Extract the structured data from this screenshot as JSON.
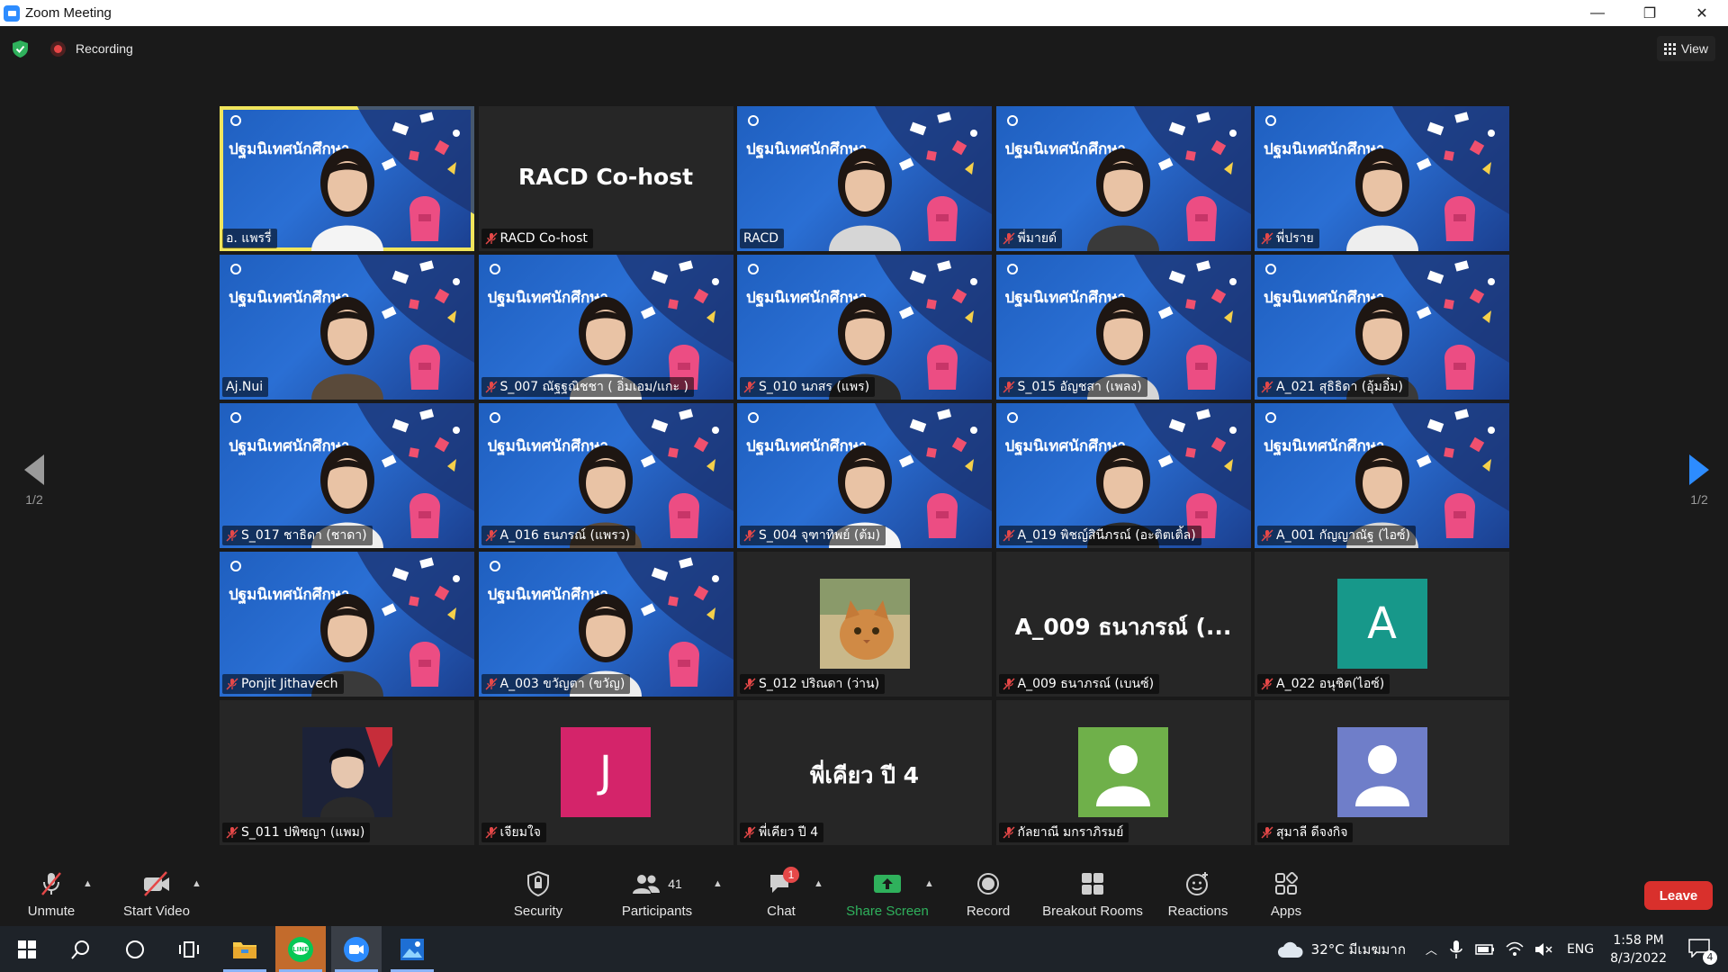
{
  "window": {
    "title": "Zoom Meeting",
    "controls": [
      "—",
      "❐",
      "✕"
    ]
  },
  "topbar": {
    "recording_label": "Recording",
    "view_label": "View"
  },
  "pagination": {
    "left_label": "1/2",
    "right_label": "1/2"
  },
  "colors": {
    "accent": "#2d8cff",
    "active_speaker": "#f0e55c",
    "leave": "#d9302c",
    "share": "#2fb15c",
    "muted": "#e54848"
  },
  "banner_text": "ปฐมนิเทศนักศึกษา",
  "tiles": [
    {
      "name": "อ. แพรรี่",
      "type": "video",
      "muted": false,
      "active": true
    },
    {
      "name": "RACD Co-host",
      "type": "name",
      "display": "RACD Co-host",
      "muted": true
    },
    {
      "name": "RACD",
      "type": "video",
      "muted": false
    },
    {
      "name": "พี่มายด์",
      "type": "video",
      "muted": true
    },
    {
      "name": "พี่ปราย",
      "type": "video",
      "muted": true
    },
    {
      "name": "Aj.Nui",
      "type": "video",
      "muted": false
    },
    {
      "name": "S_007 ณัฐฐณิชชา ( อิ่มเอม/แกะ )",
      "type": "video",
      "muted": true
    },
    {
      "name": "S_010 นภสร (แพร)",
      "type": "video",
      "muted": true
    },
    {
      "name": "S_015 อัญชสา (เพลง)",
      "type": "video",
      "muted": true
    },
    {
      "name": "A_021 สุธิธิดา (อุ้มอิ๋ม)",
      "type": "video",
      "muted": true
    },
    {
      "name": "S_017 ชาธิดา (ชาดา)",
      "type": "video",
      "muted": true
    },
    {
      "name": "A_016 ธนภรณ์ (แพรว)",
      "type": "video",
      "muted": true
    },
    {
      "name": "S_004 จุฑาทิพย์ (ต้ม)",
      "type": "video",
      "muted": true
    },
    {
      "name": "A_019 พิชญ์สินีภรณ์ (อะติตเติ้ล)",
      "type": "video",
      "muted": true
    },
    {
      "name": "A_001 กัญญาณัฐ (ไอซ์)",
      "type": "video",
      "muted": true
    },
    {
      "name": "Ponjit Jithavech",
      "type": "video",
      "muted": true
    },
    {
      "name": "A_003 ขวัญตา (ขวัญ)",
      "type": "video",
      "muted": true
    },
    {
      "name": "S_012 ปริณดา (ว่าน)",
      "type": "photo",
      "photo": "cat",
      "muted": true
    },
    {
      "name": "A_009 ธนาภรณ์ (เบนซ์)",
      "type": "name",
      "display": "A_009 ธนาภรณ์ (...",
      "muted": true
    },
    {
      "name": "A_022 อนุชิต(ไอซ์)",
      "type": "letter",
      "letter": "A",
      "avatar_color": "#17988a",
      "muted": true
    },
    {
      "name": "S_011 ปพิชญา (แพม)",
      "type": "photo",
      "photo": "portrait",
      "muted": true
    },
    {
      "name": "เจียมใจ",
      "type": "letter",
      "letter": "J",
      "avatar_color": "#d4246a",
      "muted": true
    },
    {
      "name": "พี่เคียว ปี 4",
      "type": "name",
      "display": "พี่เคียว ปี 4",
      "muted": true
    },
    {
      "name": "กัลยาณี มกราภิรมย์",
      "type": "person",
      "avatar_color": "#6fb04a",
      "muted": true
    },
    {
      "name": "สุมาลี ดีจงกิจ",
      "type": "person",
      "avatar_color": "#6f7ec9",
      "muted": true
    }
  ],
  "toolbar": {
    "unmute": "Unmute",
    "start_video": "Start Video",
    "security": "Security",
    "participants": "Participants",
    "participants_count": "41",
    "chat": "Chat",
    "chat_badge": "1",
    "share_screen": "Share Screen",
    "record": "Record",
    "breakout_rooms": "Breakout Rooms",
    "reactions": "Reactions",
    "apps": "Apps",
    "leave": "Leave"
  },
  "taskbar": {
    "weather": "32°C มีเมฆมาก",
    "language": "ENG",
    "time": "1:58 PM",
    "date": "8/3/2022",
    "notification_count": "4"
  }
}
